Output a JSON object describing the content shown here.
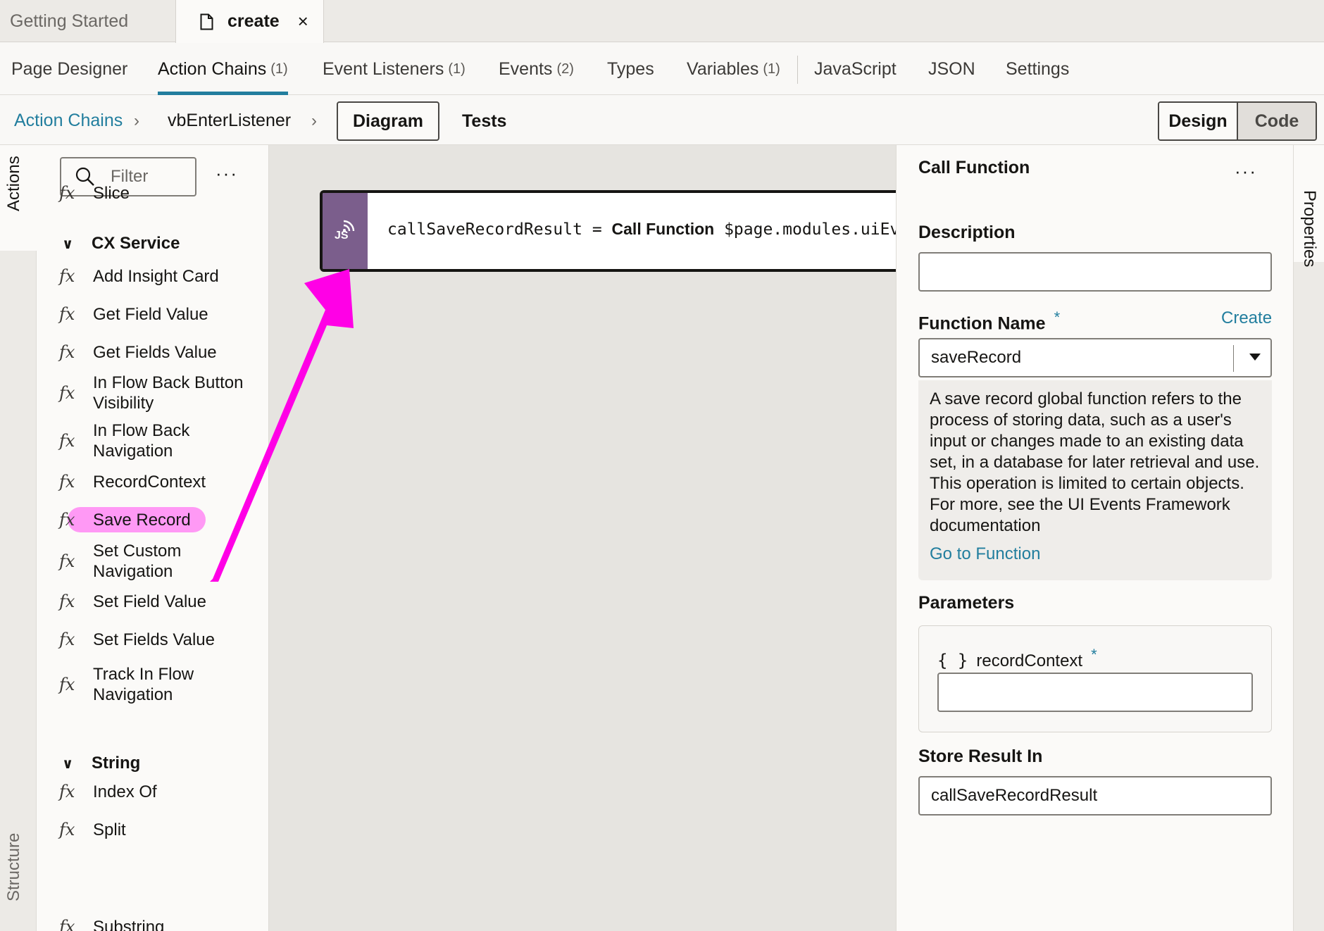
{
  "file_tabs": [
    {
      "label": "Getting Started"
    },
    {
      "label": "create",
      "close": "×"
    }
  ],
  "editor_tabs": [
    {
      "label": "Page Designer",
      "count": ""
    },
    {
      "label": "Action Chains",
      "count": "(1)"
    },
    {
      "label": "Event Listeners",
      "count": "(1)"
    },
    {
      "label": "Events",
      "count": "(2)"
    },
    {
      "label": "Types",
      "count": ""
    },
    {
      "label": "Variables",
      "count": "(1)"
    },
    {
      "label": "JavaScript",
      "count": ""
    },
    {
      "label": "JSON",
      "count": ""
    },
    {
      "label": "Settings",
      "count": ""
    }
  ],
  "breadcrumb": {
    "root": "Action Chains",
    "current": "vbEnterListener",
    "chevron": "›"
  },
  "view_buttons": {
    "diagram": "Diagram",
    "tests": "Tests"
  },
  "mode_toggle": {
    "design": "Design",
    "code": "Code",
    "selected": "Design"
  },
  "left_rail": {
    "actions": "Actions",
    "structure": "Structure"
  },
  "palette": {
    "filter_placeholder": "Filter",
    "more": "···",
    "top_items": [
      "Slice"
    ],
    "groups": [
      {
        "name": "CX Service",
        "items": [
          "Add Insight Card",
          "Get Field Value",
          "Get Fields Value",
          "In Flow Back Button Visibility",
          "In Flow Back Navigation",
          "RecordContext",
          "Save Record",
          "Set Custom Navigation",
          "Set Field Value",
          "Set Fields Value",
          "Track In Flow Navigation"
        ]
      },
      {
        "name": "String",
        "items": [
          "Index Of",
          "Split",
          "Substring"
        ]
      }
    ],
    "fx_label": "fx",
    "highlighted": "Save Record"
  },
  "canvas": {
    "node": {
      "icon_label": "JS",
      "result_var": "callSaveRecordResult",
      "equals": "=",
      "action": "Call Function",
      "target": "$page.modules.uiEvents"
    }
  },
  "properties": {
    "title": "Call Function",
    "more": "···",
    "rail_label": "Properties",
    "description_label": "Description",
    "description_value": "",
    "function_name_label": "Function Name",
    "required_mark": "*",
    "create_link": "Create",
    "function_name_value": "saveRecord",
    "function_description": "A save record global function refers to the process of storing data, such as a user's input or changes made to an existing data set, in a database for later retrieval and use. This operation is limited to certain objects. For more, see the UI Events Framework documentation",
    "goto_link": "Go to Function",
    "parameters_label": "Parameters",
    "param_braces": "{ }",
    "param_name": "recordContext",
    "param_value": "",
    "store_result_label": "Store Result In",
    "store_result_value": "callSaveRecordResult"
  },
  "colors": {
    "accent": "#227e9e",
    "annotation_pink": "#ff00e6",
    "js_icon": "#7b5e8c"
  }
}
